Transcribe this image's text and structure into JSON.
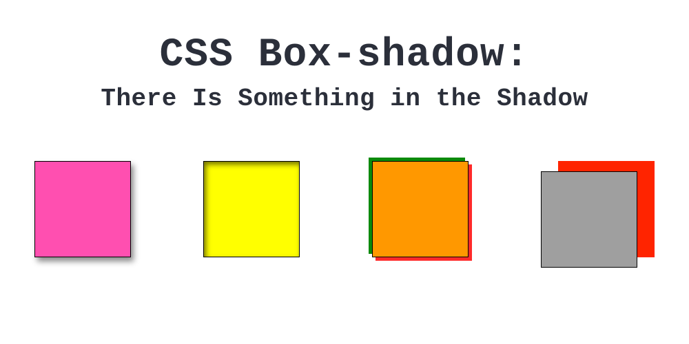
{
  "title": "CSS Box-shadow:",
  "subtitle": "There Is Something in the Shadow",
  "boxes": {
    "box1": {
      "color": "#ff4fb0",
      "effect": "drop-shadow"
    },
    "box2": {
      "color": "#ffff00",
      "effect": "inset-shadow"
    },
    "box3": {
      "color": "#ff9800",
      "effect": "multi-color-shadow",
      "shadow_colors": [
        "#0b8a0b",
        "#ff2a2a"
      ]
    },
    "box4": {
      "color": "#9f9f9f",
      "effect": "offset-layer",
      "back_color": "#ff2400"
    }
  }
}
